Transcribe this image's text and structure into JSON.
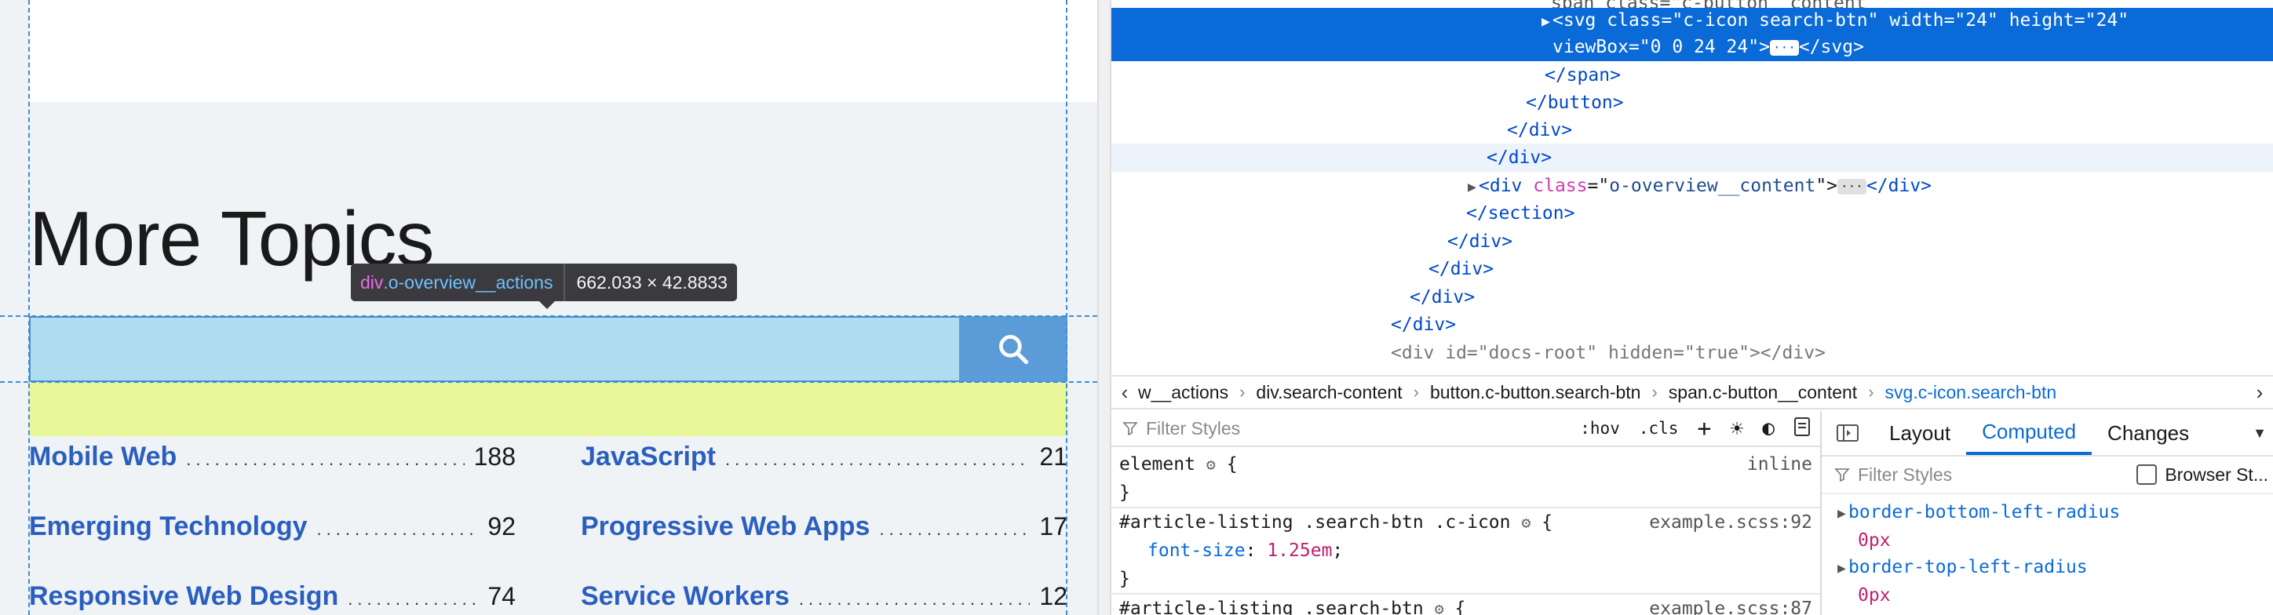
{
  "page": {
    "heading": "More Topics",
    "tooltip": {
      "selector_tag": "div",
      "selector_class": ".o-overview__actions",
      "dimensions": "662.033 × 42.8833"
    },
    "topics": [
      {
        "name": "Mobile Web",
        "count": "188"
      },
      {
        "name": "JavaScript",
        "count": "21"
      },
      {
        "name": "Emerging Technology",
        "count": "92"
      },
      {
        "name": "Progressive Web Apps",
        "count": "17"
      },
      {
        "name": "Responsive Web Design",
        "count": "74"
      },
      {
        "name": "Service Workers",
        "count": "12"
      }
    ],
    "colors": {
      "search_button": "#5b9bd8",
      "overlay": "#b0ddf0",
      "padding_highlight": "#e8f79a"
    }
  },
  "devtools": {
    "markup": [
      {
        "text_prefix": "",
        "partial": "span class=\"c-button__content"
      },
      {
        "tag": "svg",
        "attrs": [
          [
            "class",
            "c-icon search-btn"
          ],
          [
            "width",
            "24"
          ],
          [
            "height",
            "24"
          ]
        ],
        "cont": "viewBox=\"0 0 24 24\">",
        "close": "</svg>"
      },
      {
        "close_tag": "</span>"
      },
      {
        "close_tag": "</button>"
      },
      {
        "close_tag": "</div>"
      },
      {
        "close_tag": "</div>"
      },
      {
        "tag": "div",
        "attrs": [
          [
            "class",
            "o-overview__content"
          ]
        ],
        "close": "</div>"
      },
      {
        "close_tag": "</section>"
      },
      {
        "close_tag": "</div>"
      },
      {
        "close_tag": "</div>"
      },
      {
        "close_tag": "</div>"
      },
      {
        "close_tag": "</div>"
      },
      {
        "raw": "<div id=\"docs-root\" hidden=\"true\"></div>"
      }
    ],
    "breadcrumbs": [
      "w__actions",
      "div.search-content",
      "button.c-button.search-btn",
      "span.c-button__content",
      "svg.c-icon.search-btn"
    ],
    "rules_toolbar": {
      "filter_placeholder": "Filter Styles",
      "hov": ":hov",
      "cls": ".cls"
    },
    "rules": [
      {
        "selector": "element",
        "source": "inline",
        "decls": []
      },
      {
        "selector": "#article-listing .search-btn .c-icon",
        "source": "example.scss:92",
        "decls": [
          {
            "prop": "font-size",
            "value": "1.25em"
          }
        ]
      },
      {
        "selector": "#article-listing .search-btn",
        "source": "example.scss:87"
      }
    ],
    "sidebar_tabs": [
      "Layout",
      "Computed",
      "Changes"
    ],
    "active_tab": "Computed",
    "computed_filter_placeholder": "Filter Styles",
    "browser_styles_label": "Browser St...",
    "computed": [
      {
        "prop": "border-bottom-left-radius",
        "value": "0px"
      },
      {
        "prop": "border-top-left-radius",
        "value": "0px"
      }
    ]
  }
}
